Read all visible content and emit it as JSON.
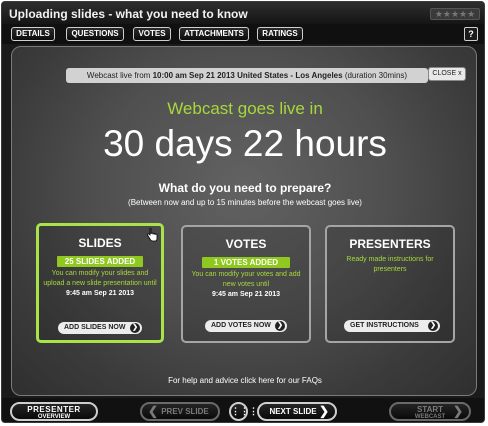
{
  "window": {
    "title": "Uploading slides - what you need to know",
    "rating_stars": "★★★★★"
  },
  "tabs": [
    {
      "label": "DETAILS"
    },
    {
      "label": "QUESTIONS"
    },
    {
      "label": "VOTES"
    },
    {
      "label": "ATTACHMENTS"
    },
    {
      "label": "RATINGS"
    }
  ],
  "help_label": "?",
  "webcast_bar": {
    "prefix": "Webcast live from ",
    "time": "10:00 am Sep 21 2013 United States - Los Angeles",
    "duration": " (duration 30mins)",
    "close_label": "CLOSE x"
  },
  "countdown": {
    "heading": "Webcast goes live in",
    "value": "30 days 22 hours"
  },
  "prepare": {
    "question": "What do you need to prepare?",
    "subtitle": "(Between now and up to 15 minutes before the webcast goes live)"
  },
  "cards": {
    "slides": {
      "title": "SLIDES",
      "badge": "25 SLIDES ADDED",
      "text": "You can modify your slides and upload a new slide presentation until",
      "deadline": "9:45 am Sep 21 2013",
      "button": "ADD SLIDES NOW"
    },
    "votes": {
      "title": "VOTES",
      "badge": "1 VOTES ADDED",
      "text": "You can modify your votes and add new votes until",
      "deadline": "9:45 am Sep 21 2013",
      "button": "ADD VOTES NOW"
    },
    "presenters": {
      "title": "PRESENTERS",
      "text": "Ready made instructions for presenters",
      "button": "GET INSTRUCTIONS"
    }
  },
  "faq_text": "For help and advice click here for our FAQs",
  "bottom": {
    "presenter_l1": "PRESENTER",
    "presenter_l2": "OVERVIEW",
    "prev": "PREV SLIDE",
    "next": "NEXT SLIDE",
    "start_l1": "START",
    "start_l2": "WEBCAST"
  },
  "colors": {
    "accent_green": "#a7d83a",
    "badge_green": "#8fc81f"
  }
}
